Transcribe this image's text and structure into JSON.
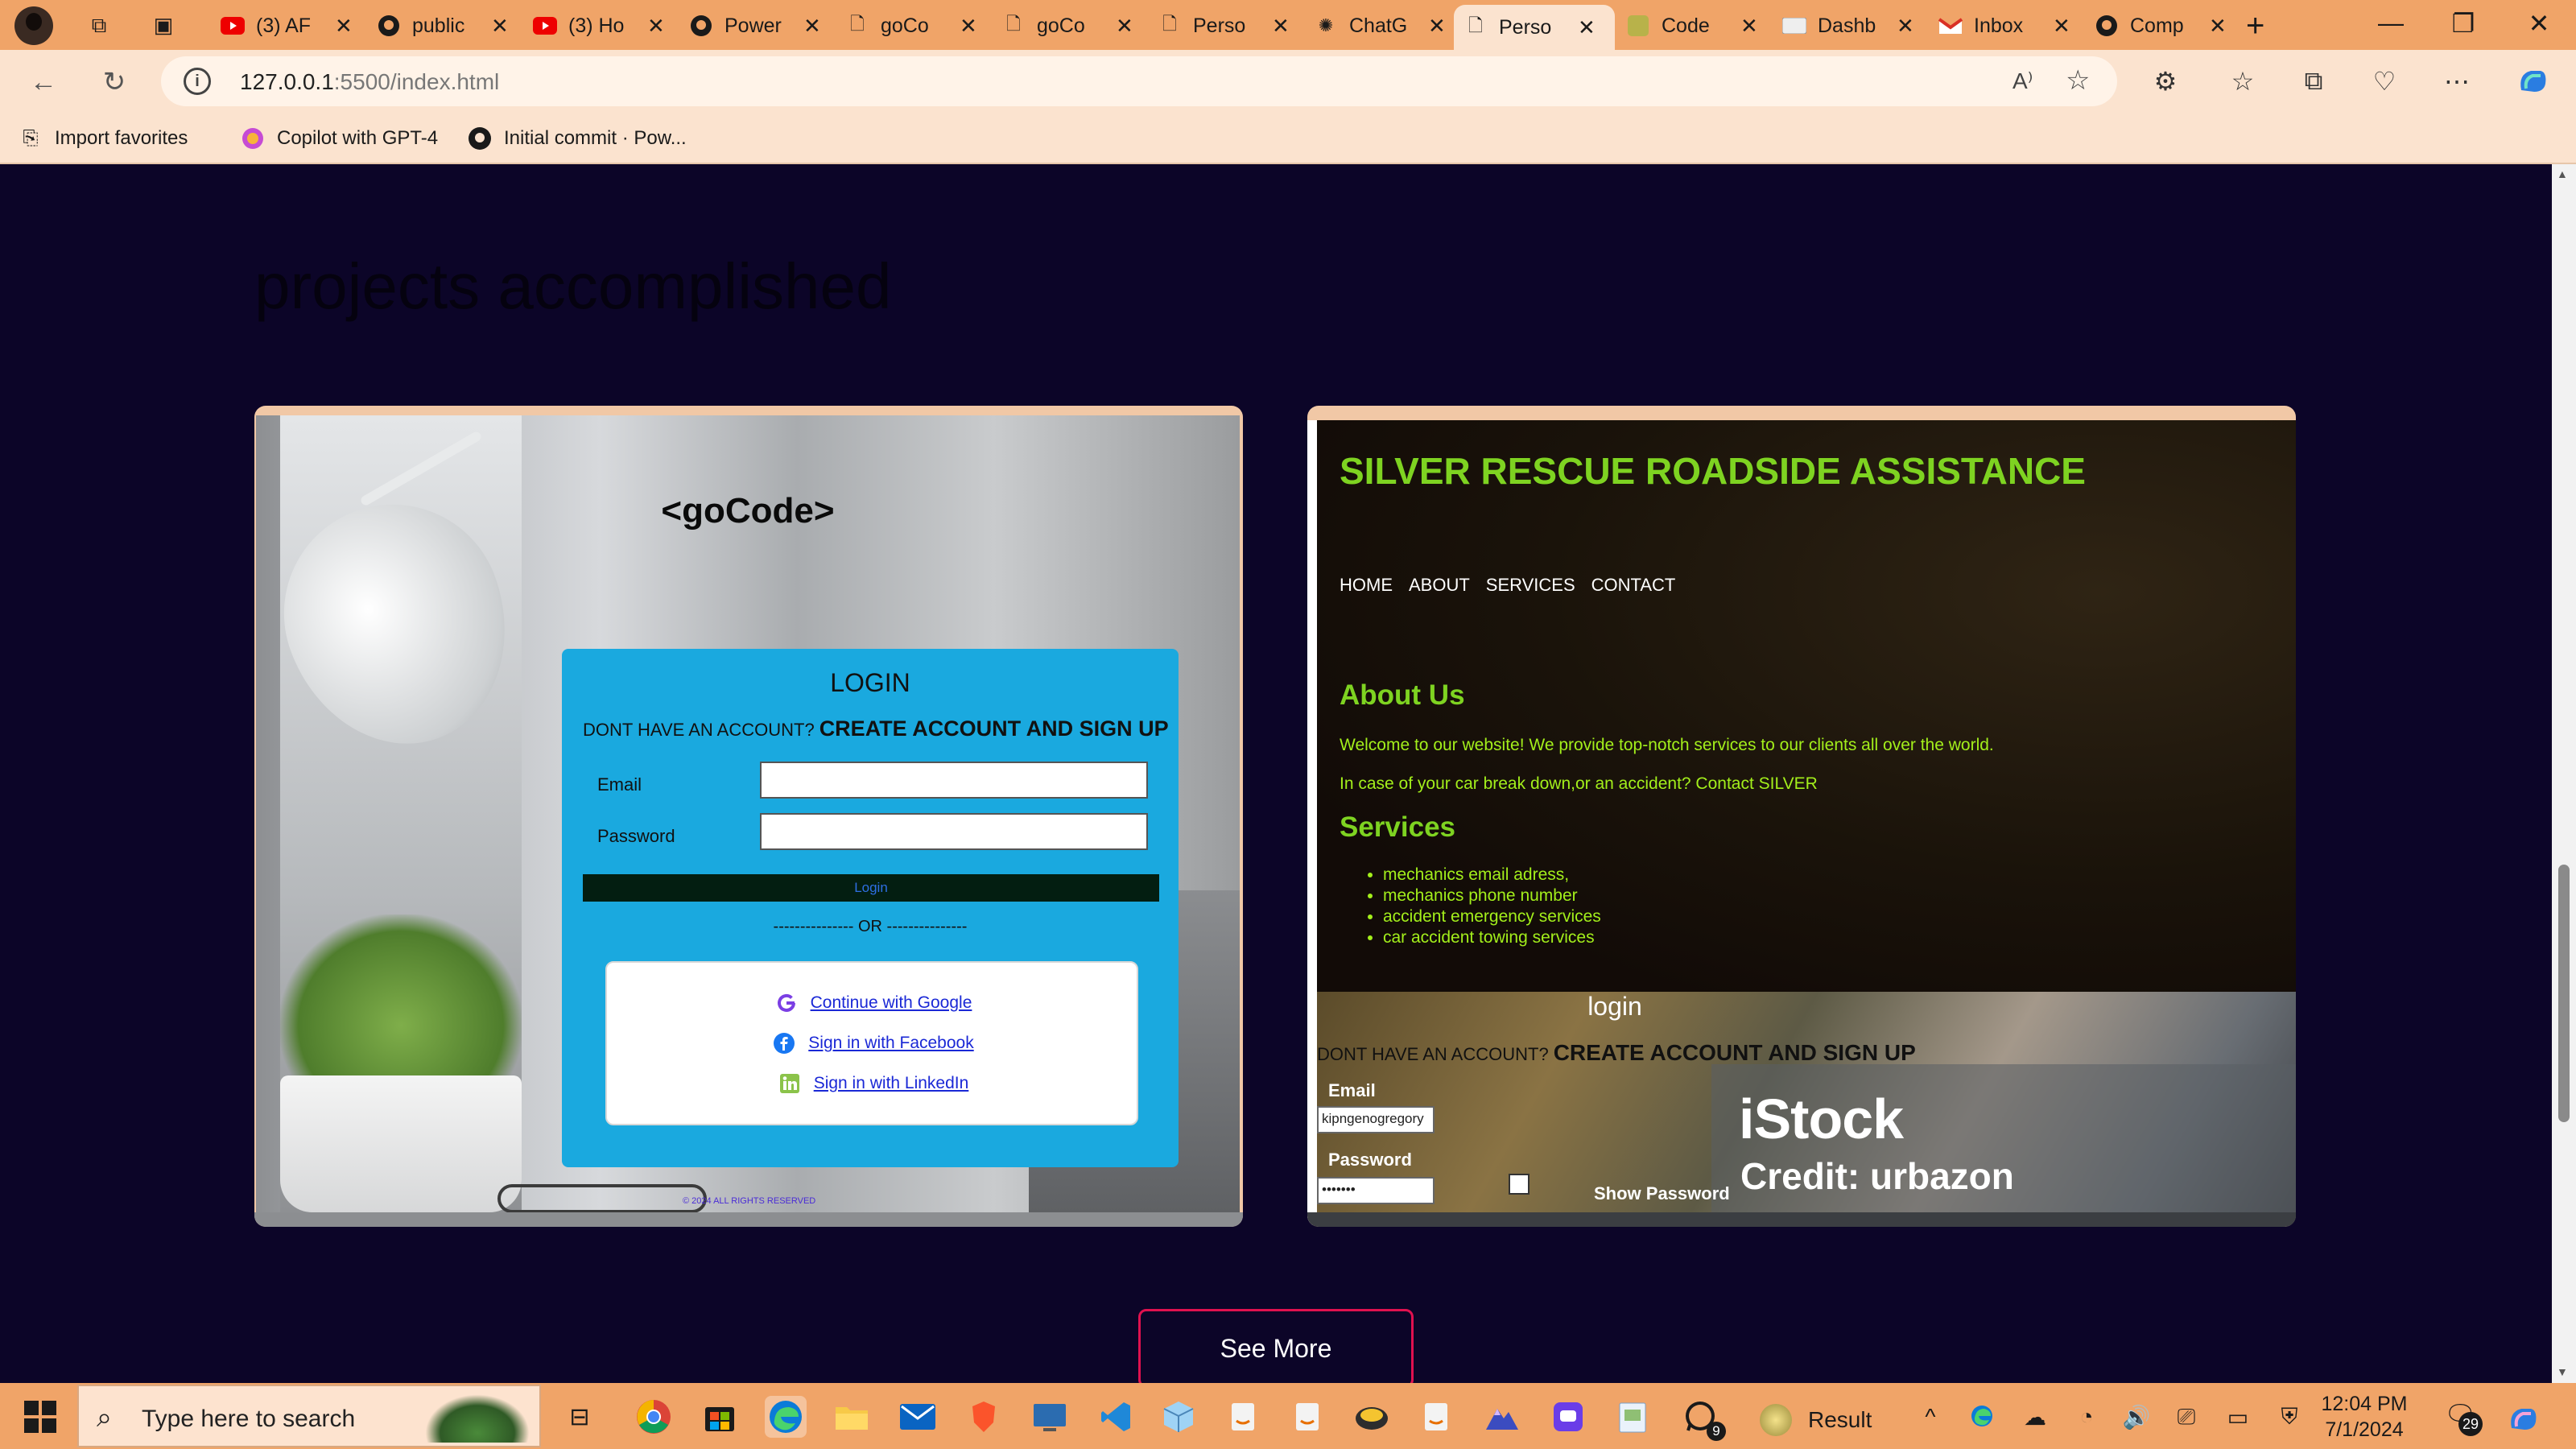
{
  "browser": {
    "tabs": [
      {
        "title": "(3) AF",
        "icon": "youtube-icon"
      },
      {
        "title": "public",
        "icon": "github-icon"
      },
      {
        "title": "(3) Ho",
        "icon": "youtube-icon"
      },
      {
        "title": "Power",
        "icon": "github-icon"
      },
      {
        "title": "goCo",
        "icon": "page-icon"
      },
      {
        "title": "goCo",
        "icon": "page-icon"
      },
      {
        "title": "Perso",
        "icon": "page-icon"
      },
      {
        "title": "ChatG",
        "icon": "chatgpt-icon"
      },
      {
        "title": "Perso",
        "icon": "page-icon",
        "active": true
      },
      {
        "title": "Code",
        "icon": "code-icon"
      },
      {
        "title": "Dashb",
        "icon": "dashboard-icon"
      },
      {
        "title": "Inbox",
        "icon": "gmail-icon"
      },
      {
        "title": "Comp",
        "icon": "github-icon"
      }
    ],
    "address": {
      "host": "127.0.0.1",
      "path": ":5500/index.html"
    },
    "favorites": [
      {
        "label": "Import favorites",
        "icon": "import-icon"
      },
      {
        "label": "Copilot with GPT-4",
        "icon": "copilot-icon"
      },
      {
        "label": "Initial commit · Pow...",
        "icon": "github-icon"
      }
    ],
    "colors": {
      "chrome": "#f0a468",
      "toolbar": "#fbe3cf"
    }
  },
  "page": {
    "section_title": "projects accomplished",
    "see_more": "See More",
    "background": "#0c0528"
  },
  "project1": {
    "brand": "<goCode>",
    "login_title": "LOGIN",
    "no_account": "DONT HAVE AN ACCOUNT?",
    "create_account": "CREATE ACCOUNT AND SIGN UP",
    "email_label": "Email",
    "password_label": "Password",
    "login_button": "Login",
    "or_divider": "--------------- OR ---------------",
    "social": [
      {
        "label": "Continue with Google",
        "icon": "google-icon"
      },
      {
        "label": "Sign in with Facebook",
        "icon": "facebook-icon"
      },
      {
        "label": "Sign in with LinkedIn",
        "icon": "linkedin-icon"
      }
    ],
    "footer": "© 2024 ALL RIGHTS RESERVED",
    "panel_color": "#1aa9df"
  },
  "project2": {
    "title": "SILVER RESCUE ROADSIDE ASSISTANCE",
    "nav": [
      "HOME",
      "ABOUT",
      "SERVICES",
      "CONTACT"
    ],
    "about_heading": "About Us",
    "about_p1": "Welcome to our website! We provide top-notch services to our clients all over the world.",
    "about_p2": "In case of your car break down,or an accident? Contact SILVER",
    "services_heading": "Services",
    "services": [
      "mechanics email adress,",
      "mechanics phone number",
      "accident emergency services",
      "car accident towing services"
    ],
    "login_title": "login",
    "no_account": "DONT HAVE AN ACCOUNT?",
    "create_account": "CREATE ACCOUNT AND SIGN UP",
    "email_label": "Email",
    "email_value": "kipngenogregory",
    "password_label": "Password",
    "password_value": "•••••••",
    "show_password": "Show Password",
    "watermark": "iStock",
    "credit": "Credit: urbazon",
    "accent": "#7ed321"
  },
  "taskbar": {
    "search_placeholder": "Type here to search",
    "apps": [
      "task-view-icon",
      "chrome-icon",
      "store-icon",
      "edge-icon",
      "file-explorer-icon",
      "mail-icon",
      "brave-icon",
      "remote-desktop-icon",
      "vscode-icon",
      "cube-icon",
      "java-icon",
      "java-icon",
      "wsl-icon",
      "java-icon",
      "mountain-app-icon",
      "chat-app-icon",
      "notepad-icon",
      "whatsapp-icon"
    ],
    "whatsapp_badge": "9",
    "result_label": "Result",
    "time": "12:04 PM",
    "date": "7/1/2024",
    "notifications": "29"
  }
}
